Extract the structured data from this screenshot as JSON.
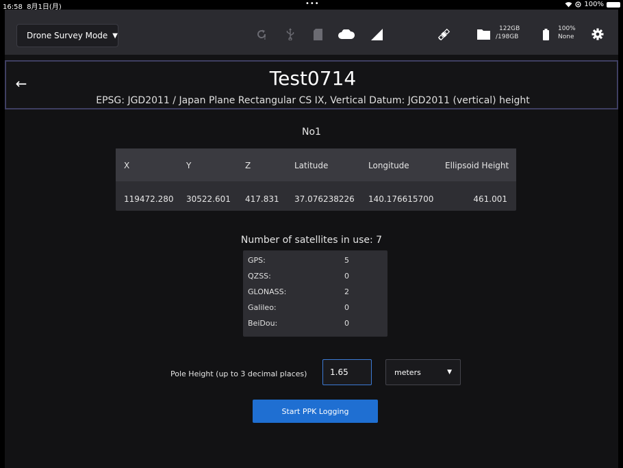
{
  "status_bar": {
    "time": "16:58",
    "date": "8月1日(月)",
    "dots": "•••",
    "battery_percent": "100%"
  },
  "toolbar": {
    "mode_label": "Drone Survey Mode",
    "icons": [
      "refresh-alert-icon",
      "usb-icon",
      "sd-card-icon",
      "cloud-icon",
      "signal-icon",
      "satellite-icon",
      "folder-icon",
      "battery-icon",
      "gear-icon"
    ],
    "storage": {
      "used": "122GB",
      "total": "/198GB"
    },
    "battery": {
      "percent": "100%",
      "status": "None"
    }
  },
  "header": {
    "title": "Test0714",
    "subtitle": "EPSG: JGD2011 / Japan Plane Rectangular CS IX, Vertical Datum: JGD2011 (vertical) height"
  },
  "point_name": "No1",
  "coordinates": {
    "headers": [
      "X",
      "Y",
      "Z",
      "Latitude",
      "Longitude",
      "Ellipsoid Height"
    ],
    "values": [
      "119472.280",
      "30522.601",
      "417.831",
      "37.076238226",
      "140.176615700",
      "461.001"
    ]
  },
  "satellites": {
    "title": "Number of satellites in use: 7",
    "rows": [
      {
        "label": "GPS:",
        "value": "5"
      },
      {
        "label": "QZSS:",
        "value": "0"
      },
      {
        "label": "GLONASS:",
        "value": "2"
      },
      {
        "label": "Galileo:",
        "value": "0"
      },
      {
        "label": "BeiDou:",
        "value": "0"
      }
    ]
  },
  "pole": {
    "label": "Pole Height (up to 3 decimal places)",
    "value": "1.65",
    "unit": "meters"
  },
  "start_button": "Start PPK Logging",
  "colors": {
    "accent": "#1f6fd2",
    "input_border": "#3c7bd6",
    "toolbar_bg": "#2b2b30",
    "panel_bg": "#2e2e33"
  }
}
